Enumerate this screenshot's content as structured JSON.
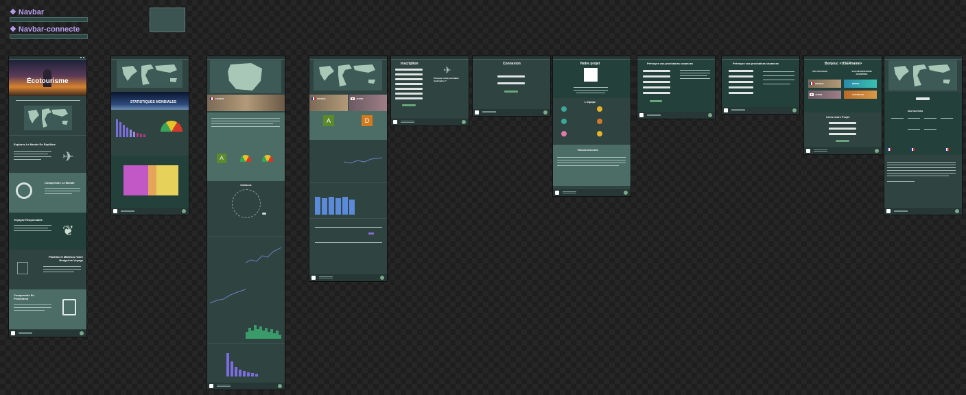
{
  "components": {
    "navbar": "Navbar",
    "navbar_connected": "Navbar-connecte"
  },
  "home": {
    "hero_title": "Écotourisme",
    "features": [
      {
        "title": "Explorez Le Monde En Équilibre"
      },
      {
        "title": "Comprendre Le Monde"
      },
      {
        "title": "Voyagez Responsable"
      },
      {
        "title": "Planifiez et Maîtrisez Votre Budget de Voyage"
      },
      {
        "title": "Comprendre En Profondeur"
      }
    ]
  },
  "stats": {
    "title": "STATISTIQUES MONDIALES"
  },
  "country": {
    "name": "FRANCE",
    "score": "A",
    "radar_title": "VOISINAGE"
  },
  "compare": {
    "country_a": "FRANCE",
    "country_b": "JAPON",
    "score_a": "A",
    "score_b": "D"
  },
  "inscription": {
    "title": "Inscription",
    "side_text": "Prêt pour votre prochaine destination ?"
  },
  "connexion": {
    "title": "Connexion"
  },
  "project": {
    "title": "Notre projet",
    "team_title": "L'équipe",
    "thanks_title": "Remerciements"
  },
  "plan1": {
    "title": "Prévoyez vos prochaines vacances"
  },
  "plan2": {
    "title": "Prévoyez vos prochaines vacances"
  },
  "welcome": {
    "title": "Bonjour, <USERname>",
    "col1": "VOS VOYAGES",
    "col2": "VOS DESTINATIONS FAVORITES",
    "trips": [
      "FRANCE",
      "JAPON"
    ],
    "favorites": [
      "BRÉSIL",
      "AUSTRALIE"
    ],
    "form_title": "Créez votre Projet"
  },
  "last": {
    "tag": "DESTINATIONS"
  },
  "colors": {
    "frame_bg": "#2f4340",
    "light_section": "#4b6d66",
    "dark_section": "#23413a",
    "label_purple": "#b69ff0"
  }
}
